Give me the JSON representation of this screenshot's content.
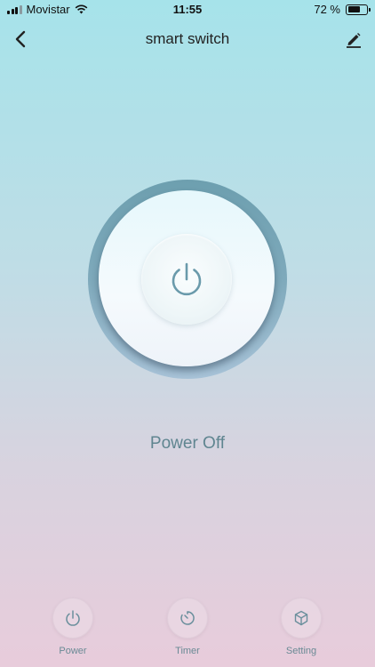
{
  "status_bar": {
    "carrier": "Movistar",
    "time": "11:55",
    "battery_percent_text": "72 %",
    "battery_level": 0.72
  },
  "nav": {
    "title": "smart switch",
    "back_icon": "chevron-left-icon",
    "edit_icon": "pencil-icon"
  },
  "device": {
    "power_icon": "power-icon",
    "status_text": "Power Off",
    "is_on": false
  },
  "tabs": [
    {
      "label": "Power",
      "icon": "power-icon"
    },
    {
      "label": "Timer",
      "icon": "timer-icon"
    },
    {
      "label": "Setting",
      "icon": "cube-icon"
    }
  ],
  "colors": {
    "accent": "#6d9faf",
    "icon": "#6a8f9c",
    "status_text": "#5f8590",
    "background_top": "#a6e3ea",
    "background_bottom": "#e8ccdb"
  }
}
